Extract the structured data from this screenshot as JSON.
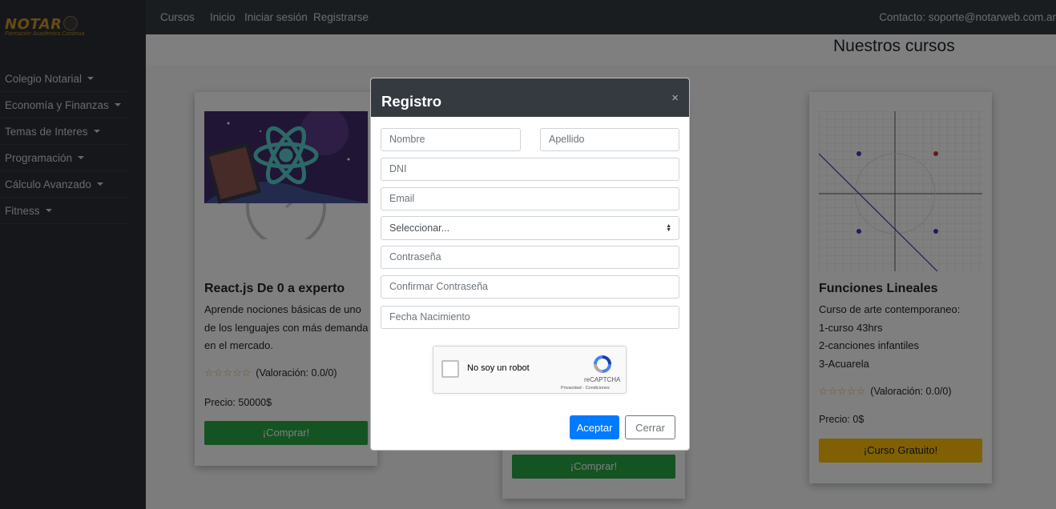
{
  "logo": {
    "brand": "NOTAR",
    "tagline": "Formación Académica Continua"
  },
  "sidebar": {
    "items": [
      {
        "label": "Colegio Notarial"
      },
      {
        "label": "Economía y Finanzas"
      },
      {
        "label": "Temas de Interes"
      },
      {
        "label": "Programación"
      },
      {
        "label": "Cálculo Avanzado"
      },
      {
        "label": "Fitness"
      }
    ]
  },
  "topnav": {
    "cursos": "Cursos",
    "inicio": "Inicio",
    "login": "Iniciar sesión",
    "register": "Registrarse",
    "contact": "Contacto: soporte@notarweb.com.ar"
  },
  "page": {
    "title": "Nuestros cursos"
  },
  "cards": [
    {
      "title": "React.js De 0 a experto",
      "desc": [
        "Aprende nociones básicas de uno",
        "de los lenguajes con más demanda",
        "en el mercado."
      ],
      "rating": "(Valoración: 0.0/0)",
      "price": "Precio: 50000$",
      "button": "¡Comprar!"
    },
    {
      "button": "¡Comprar!"
    },
    {
      "title": "Funciones Lineales",
      "desc": [
        "Curso de arte contemporaneo:",
        "1-curso 43hrs",
        "2-canciones infantiles",
        "3-Acuarela"
      ],
      "rating": "(Valoración: 0.0/0)",
      "price": "Precio: 0$",
      "button": "¡Curso Gratuito!"
    }
  ],
  "modal": {
    "title": "Registro",
    "close": "×",
    "fields": {
      "nombre": "Nombre",
      "apellido": "Apellido",
      "dni": "DNI",
      "email": "Email",
      "select": "Seleccionar...",
      "password": "Contraseña",
      "confirm": "Confirmar Contraseña",
      "birth": "Fecha Nacimiento"
    },
    "captcha": {
      "label": "No soy un robot",
      "brand": "reCAPTCHA",
      "links": "Privacidad - Condiciones"
    },
    "accept": "Aceptar",
    "cancel": "Cerrar"
  },
  "colors": {
    "accent": "#007bff",
    "buy": "#28a745",
    "free": "#ffc107",
    "dark": "#343a40"
  }
}
